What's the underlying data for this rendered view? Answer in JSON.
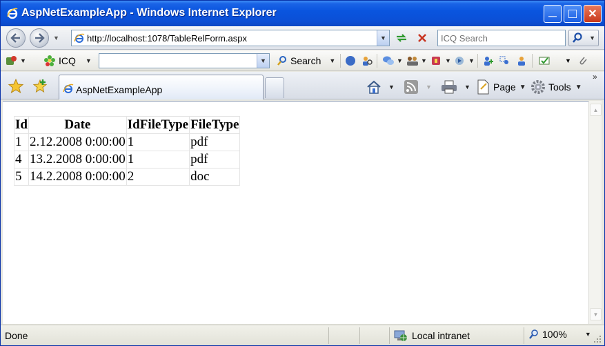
{
  "window": {
    "title": "AspNetExampleApp - Windows Internet Explorer",
    "minimize_glyph": "—",
    "maximize_glyph": "□",
    "close_glyph": "✕"
  },
  "address_bar": {
    "url": "http://localhost:1078/TableRelForm.aspx",
    "search_placeholder": "ICQ Search"
  },
  "icq_toolbar": {
    "icq_label": "ICQ",
    "search_label": "Search",
    "input_value": ""
  },
  "tabs": {
    "active_tab_label": "AspNetExampleApp"
  },
  "command_bar": {
    "page_label": "Page",
    "tools_label": "Tools"
  },
  "table": {
    "headers": [
      "Id",
      "Date",
      "IdFileType",
      "FileType"
    ],
    "rows": [
      [
        "1",
        "2.12.2008 0:00:00",
        "1",
        "pdf"
      ],
      [
        "4",
        "13.2.2008 0:00:00",
        "1",
        "pdf"
      ],
      [
        "5",
        "14.2.2008 0:00:00",
        "2",
        "doc"
      ]
    ]
  },
  "status_bar": {
    "status_text": "Done",
    "zone_label": "Local intranet",
    "zoom_label": "100%"
  },
  "colors": {
    "titlebar": "#0b4fd6",
    "close_button": "#c8391c",
    "chrome": "#e7e7e0"
  }
}
